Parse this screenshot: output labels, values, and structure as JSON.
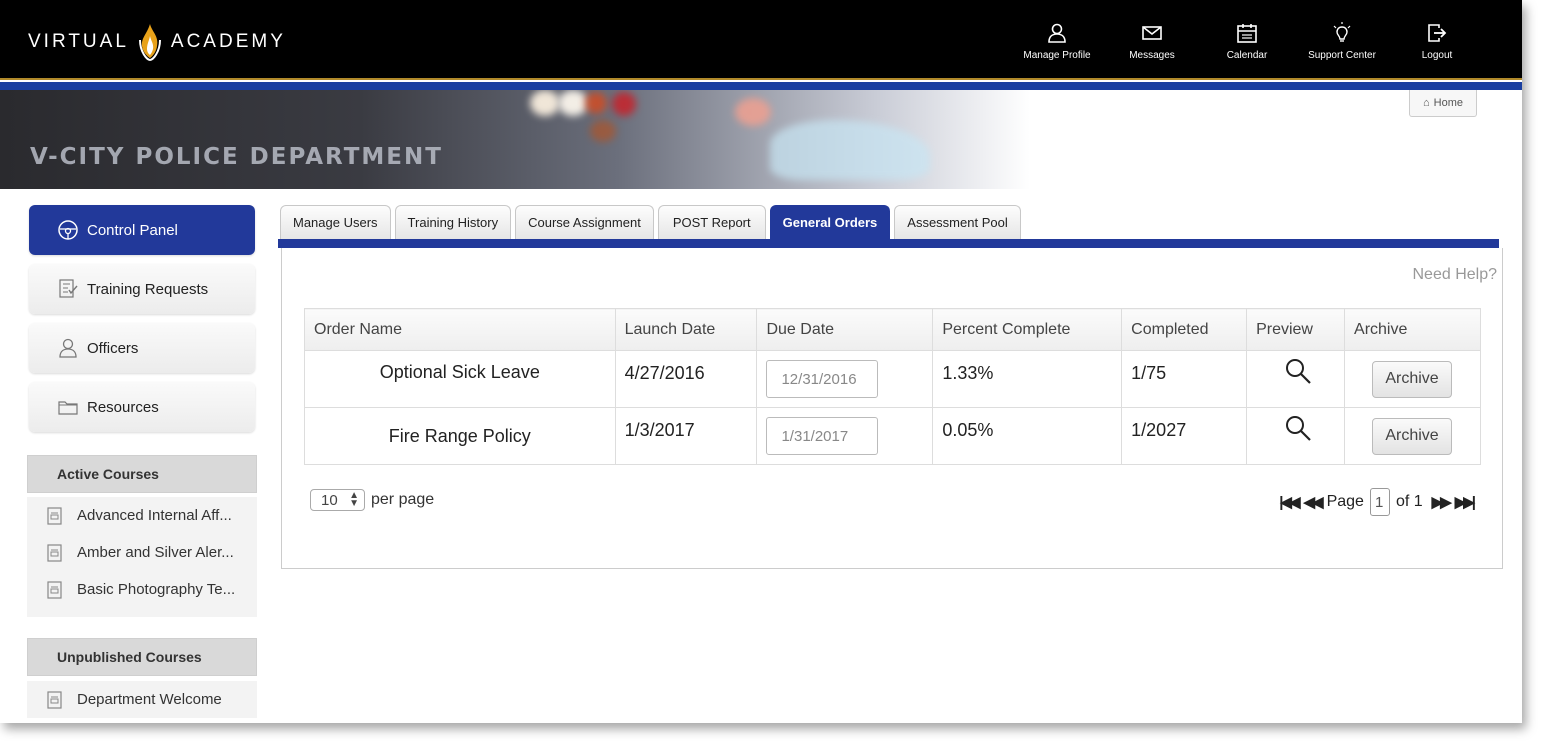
{
  "brand": {
    "left": "VIRTUAL",
    "right": "ACADEMY"
  },
  "nav": [
    {
      "label": "Manage Profile",
      "icon": "user-icon"
    },
    {
      "label": "Messages",
      "icon": "envelope-icon"
    },
    {
      "label": "Calendar",
      "icon": "calendar-icon"
    },
    {
      "label": "Support Center",
      "icon": "lightbulb-icon"
    },
    {
      "label": "Logout",
      "icon": "logout-icon"
    }
  ],
  "banner": {
    "title": "V-CITY POLICE DEPARTMENT",
    "home_label": "Home"
  },
  "sidebar": {
    "items": [
      {
        "label": "Control Panel",
        "icon": "dashboard-icon"
      },
      {
        "label": "Training Requests",
        "icon": "checklist-icon"
      },
      {
        "label": "Officers",
        "icon": "user-icon"
      },
      {
        "label": "Resources",
        "icon": "folder-icon"
      }
    ],
    "active_courses_title": "Active Courses",
    "active_courses": [
      "Advanced Internal Aff...",
      "Amber and Silver Aler...",
      "Basic Photography Te..."
    ],
    "unpublished_title": "Unpublished Courses",
    "unpublished": [
      "Department Welcome"
    ]
  },
  "tabs": [
    "Manage Users",
    "Training History",
    "Course Assignment",
    "POST Report",
    "General Orders",
    "Assessment Pool"
  ],
  "active_tab": "General Orders",
  "help_label": "Need Help?",
  "table": {
    "headers": [
      "Order Name",
      "Launch Date",
      "Due Date",
      "Percent Complete",
      "Completed",
      "Preview",
      "Archive"
    ],
    "rows": [
      {
        "name": "Optional Sick Leave",
        "launch": "4/27/2016",
        "due": "12/31/2016",
        "percent": "1.33%",
        "completed": "1/75",
        "archive": "Archive"
      },
      {
        "name": "Fire Range Policy",
        "launch": "1/3/2017",
        "due": "1/31/2017",
        "percent": "0.05%",
        "completed": "1/2027",
        "archive": "Archive"
      }
    ]
  },
  "pagination": {
    "per_page_value": "10",
    "per_page_label": "per page",
    "page_label": "Page",
    "page_value": "1",
    "of_label": "of 1"
  },
  "colors": {
    "accent": "#22399a",
    "topbar": "#000000",
    "gold": "#b08a2a"
  }
}
